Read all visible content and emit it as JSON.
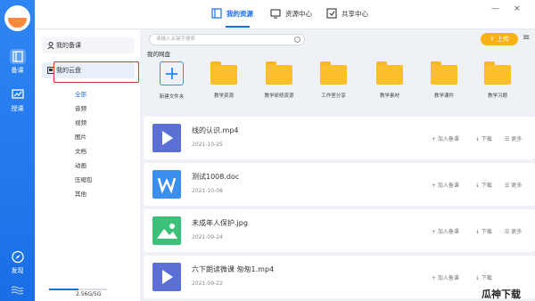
{
  "colors": {
    "accent": "#1a6ee6",
    "upload": "#f7b21a",
    "folder": "#fbbf2b",
    "highlight_box": "#e0302e"
  },
  "rail": {
    "items": [
      {
        "label": "备课",
        "icon": "book-icon"
      },
      {
        "label": "授课",
        "icon": "presentation-icon"
      },
      {
        "label": "发现",
        "icon": "compass-icon"
      }
    ]
  },
  "top_tabs": [
    {
      "label": "我的资源",
      "icon": "resource-icon"
    },
    {
      "label": "资源中心",
      "icon": "monitor-icon"
    },
    {
      "label": "共享中心",
      "icon": "share-icon"
    }
  ],
  "window": {
    "minimize": "—",
    "close": "×"
  },
  "sidebar": {
    "nav": [
      {
        "label": "我的备课",
        "icon": "person-icon"
      },
      {
        "label": "我的云盘",
        "icon": "cloud-drive-icon"
      }
    ],
    "filters": [
      "全部",
      "音频",
      "视频",
      "图片",
      "文档",
      "动画",
      "压缩包",
      "其他"
    ],
    "storage_label": "2.56G/5G",
    "storage_used_fraction": 0.512
  },
  "main": {
    "search_placeholder": "请输入关键字搜索",
    "upload_label": "上传",
    "menu_label": "≡",
    "section_title": "我的网盘",
    "folders": [
      "新建文件夹",
      "教学资源",
      "教学研修资源",
      "工作室分享",
      "教学素材",
      "教学课件",
      "教学习题"
    ],
    "files": [
      {
        "name": "线的认识.mp4",
        "date": "2021-10-25",
        "type": "video"
      },
      {
        "name": "测试1008.doc",
        "date": "2021-10-08",
        "type": "doc"
      },
      {
        "name": "未成年人保护.jpg",
        "date": "2021-09-24",
        "type": "image"
      },
      {
        "name": "六下朗读微课 匆匆1.mp4",
        "date": "2021-09-22",
        "type": "video"
      }
    ],
    "actions": [
      "+ 加入备课",
      "↓ 下载",
      "☰ 更多"
    ]
  },
  "watermark": "瓜神下载"
}
